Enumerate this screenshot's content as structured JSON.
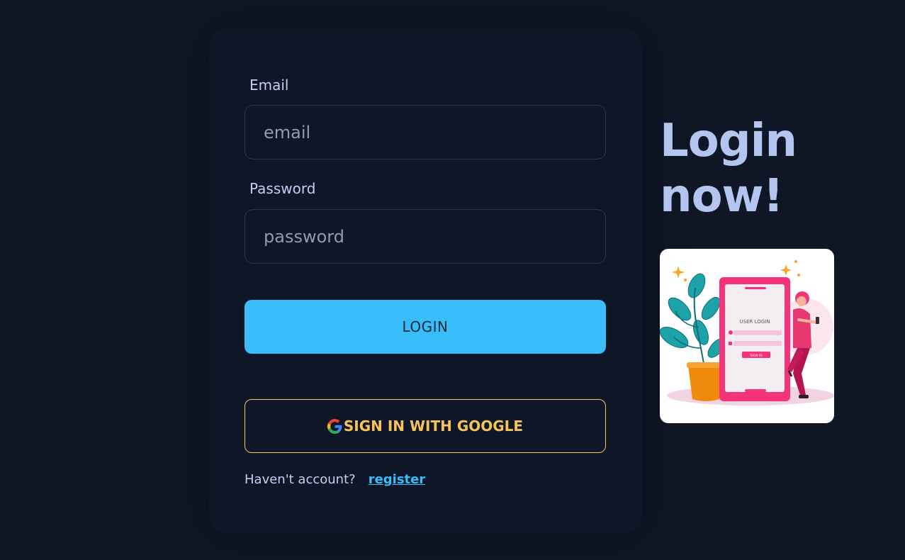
{
  "form": {
    "email_label": "Email",
    "email_placeholder": "email",
    "email_value": "",
    "password_label": "Password",
    "password_placeholder": "password",
    "password_value": "",
    "login_label": "LOGIN",
    "google_label": "SIGN IN WITH GOOGLE",
    "footer_text": "Haven't account?",
    "register_link": "register"
  },
  "hero": {
    "title_line1": "Login",
    "title_line2": "now!"
  },
  "illustration": {
    "screen_title": "USER LOGIN",
    "screen_button": "SIGN IN"
  },
  "colors": {
    "background": "#0f1626",
    "card": "#0e1628",
    "accent": "#38bdf8",
    "google_outline": "#f6c25a",
    "title": "#b4c6ef"
  },
  "icons": {
    "google": "google-g-icon"
  }
}
